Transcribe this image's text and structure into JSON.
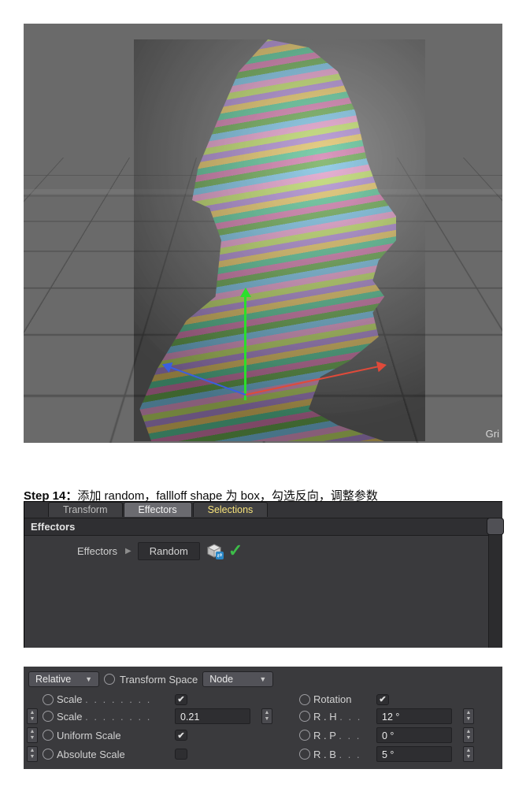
{
  "viewport": {
    "corner_label": "Gri"
  },
  "caption": {
    "prefix": "Step 14：",
    "text": "添加 random，fallloff shape 为 box，勾选反向，调整参数"
  },
  "effectors_panel": {
    "tabs": {
      "transform": "Transform",
      "effectors": "Effectors",
      "selections": "Selections"
    },
    "section_title": "Effectors",
    "row_label": "Effectors",
    "item_name": "Random"
  },
  "xform_panel": {
    "mode_dropdown": "Relative",
    "transform_space_label": "Transform Space",
    "space_dropdown": "Node",
    "left": {
      "scale_label": "Scale",
      "scale_checked": true,
      "scale_value_label": "Scale",
      "scale_value": "0.21",
      "uniform_scale_label": "Uniform Scale",
      "uniform_checked": true,
      "absolute_scale_label": "Absolute Scale",
      "absolute_checked": false
    },
    "right": {
      "rotation_label": "Rotation",
      "rotation_checked": true,
      "rh_label": "R . H",
      "rh_value": "12 °",
      "rp_label": "R . P",
      "rp_value": "0 °",
      "rb_label": "R . B",
      "rb_value": "5 °"
    }
  }
}
